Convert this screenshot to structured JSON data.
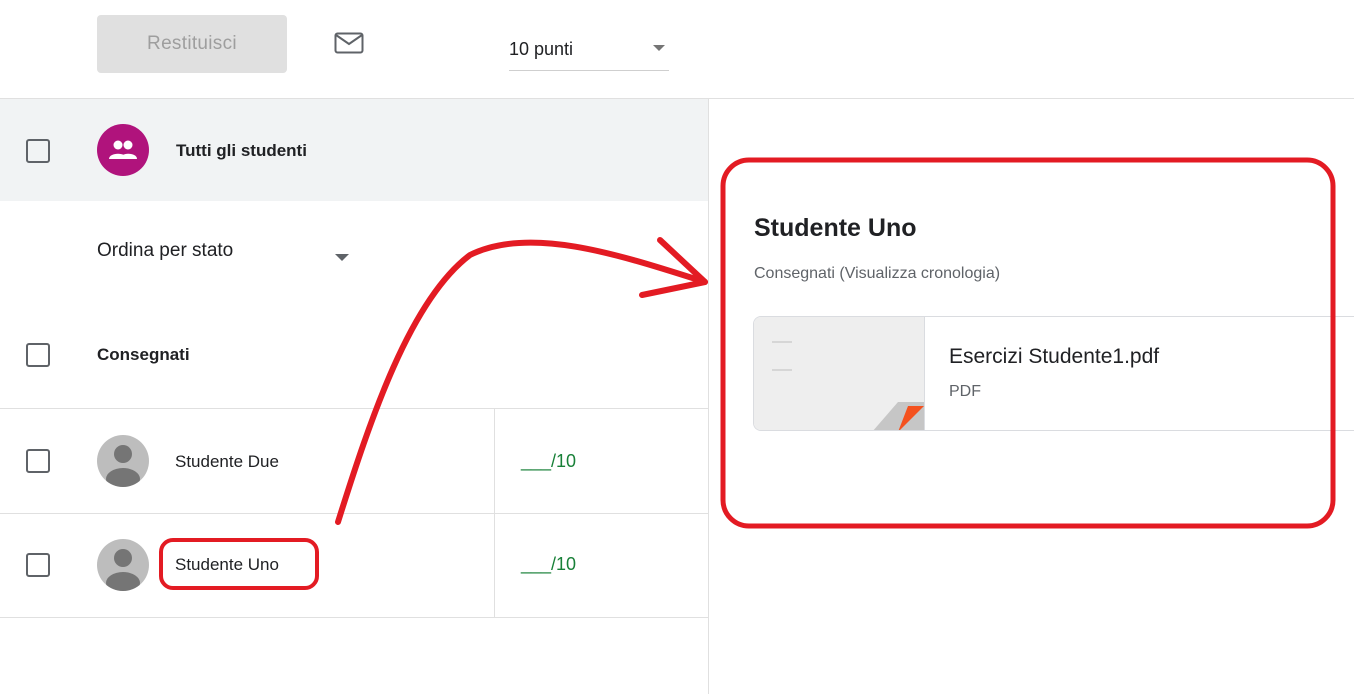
{
  "toolbar": {
    "return_label": "Restituisci",
    "mail_icon": "mail-icon",
    "points_value": "10 punti"
  },
  "roster": {
    "all_students_label": "Tutti gli studenti",
    "all_students_icon": "group-icon",
    "sort_label": "Ordina per stato",
    "section_label": "Consegnati",
    "students": [
      {
        "name": "Studente Due",
        "grade": "___/10"
      },
      {
        "name": "Studente Uno",
        "grade": "___/10"
      }
    ]
  },
  "detail": {
    "student_name": "Studente Uno",
    "status": "Consegnati (Visualizza cronologia)",
    "attachment": {
      "title": "Esercizi Studente1.pdf",
      "type": "PDF"
    }
  },
  "annotations": {
    "color": "#e31b23"
  },
  "colors": {
    "group_avatar": "#b0137c",
    "grade": "#188038",
    "pdf_corner": "#f4511e"
  }
}
